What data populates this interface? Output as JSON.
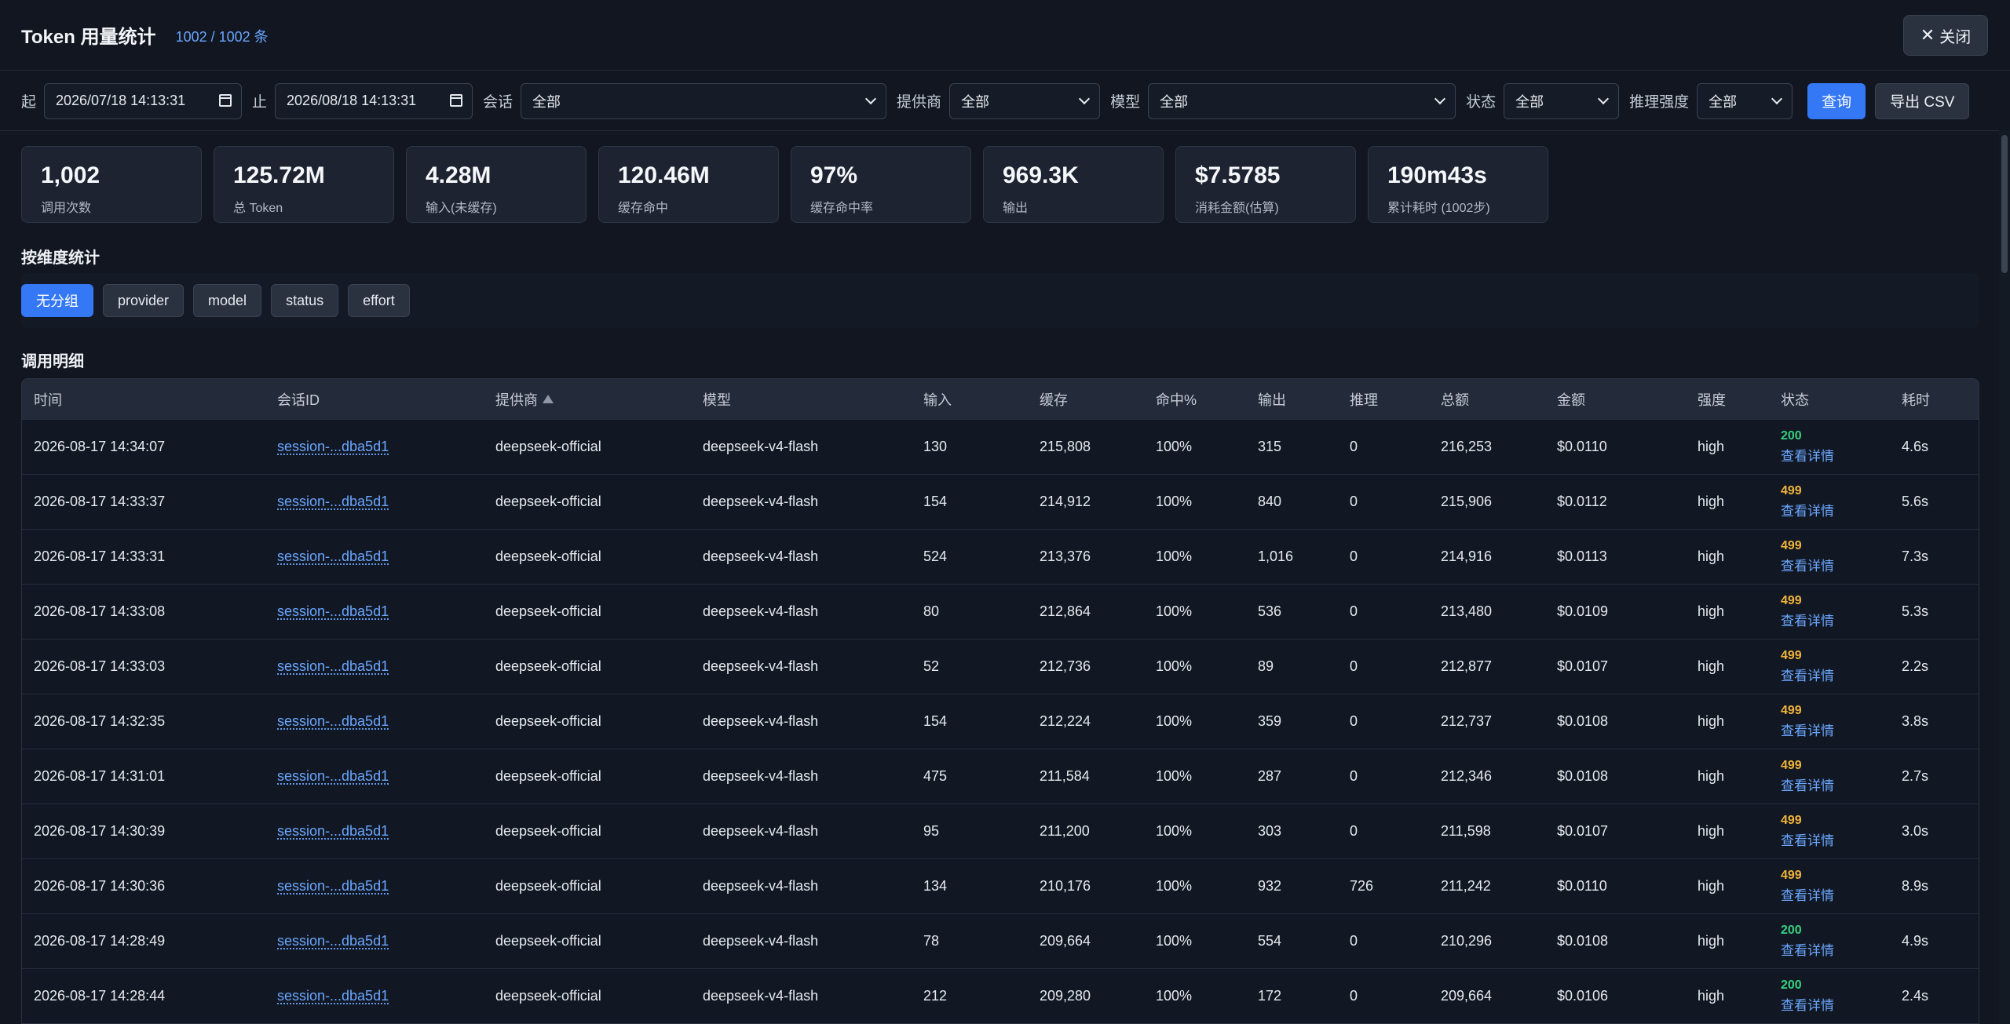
{
  "header": {
    "title": "Token 用量统计",
    "count": "1002 / 1002 条",
    "close_label": "关闭"
  },
  "filters": {
    "start_label": "起",
    "start_value": "2026/07/18 14:13:31",
    "end_label": "止",
    "end_value": "2026/08/18 14:13:31",
    "session_label": "会话",
    "session_value": "全部",
    "provider_label": "提供商",
    "provider_value": "全部",
    "model_label": "模型",
    "model_value": "全部",
    "status_label": "状态",
    "status_value": "全部",
    "effort_label": "推理强度",
    "effort_value": "全部",
    "query_label": "查询",
    "export_label": "导出 CSV"
  },
  "stats": [
    {
      "value": "1,002",
      "label": "调用次数"
    },
    {
      "value": "125.72M",
      "label": "总 Token"
    },
    {
      "value": "4.28M",
      "label": "输入(未缓存)"
    },
    {
      "value": "120.46M",
      "label": "缓存命中"
    },
    {
      "value": "97%",
      "label": "缓存命中率"
    },
    {
      "value": "969.3K",
      "label": "输出"
    },
    {
      "value": "$7.5785",
      "label": "消耗金额(估算)"
    },
    {
      "value": "190m43s",
      "label": "累计耗时 (1002步)"
    }
  ],
  "grouping": {
    "title": "按维度统计",
    "buttons": [
      {
        "label": "无分组",
        "active": true
      },
      {
        "label": "provider",
        "active": false
      },
      {
        "label": "model",
        "active": false
      },
      {
        "label": "status",
        "active": false
      },
      {
        "label": "effort",
        "active": false
      }
    ]
  },
  "table": {
    "title": "调用明细",
    "columns": [
      "时间",
      "会话ID",
      "提供商",
      "模型",
      "输入",
      "缓存",
      "命中%",
      "输出",
      "推理",
      "总额",
      "金额",
      "强度",
      "状态",
      "耗时"
    ],
    "detail_label": "查看详情",
    "rows": [
      [
        "2026-08-17 14:34:07",
        "session-...dba5d1",
        "deepseek-official",
        "deepseek-v4-flash",
        "130",
        "215,808",
        "100%",
        "315",
        "0",
        "216,253",
        "$0.0110",
        "high",
        "200",
        "4.6s"
      ],
      [
        "2026-08-17 14:33:37",
        "session-...dba5d1",
        "deepseek-official",
        "deepseek-v4-flash",
        "154",
        "214,912",
        "100%",
        "840",
        "0",
        "215,906",
        "$0.0112",
        "high",
        "499",
        "5.6s"
      ],
      [
        "2026-08-17 14:33:31",
        "session-...dba5d1",
        "deepseek-official",
        "deepseek-v4-flash",
        "524",
        "213,376",
        "100%",
        "1,016",
        "0",
        "214,916",
        "$0.0113",
        "high",
        "499",
        "7.3s"
      ],
      [
        "2026-08-17 14:33:08",
        "session-...dba5d1",
        "deepseek-official",
        "deepseek-v4-flash",
        "80",
        "212,864",
        "100%",
        "536",
        "0",
        "213,480",
        "$0.0109",
        "high",
        "499",
        "5.3s"
      ],
      [
        "2026-08-17 14:33:03",
        "session-...dba5d1",
        "deepseek-official",
        "deepseek-v4-flash",
        "52",
        "212,736",
        "100%",
        "89",
        "0",
        "212,877",
        "$0.0107",
        "high",
        "499",
        "2.2s"
      ],
      [
        "2026-08-17 14:32:35",
        "session-...dba5d1",
        "deepseek-official",
        "deepseek-v4-flash",
        "154",
        "212,224",
        "100%",
        "359",
        "0",
        "212,737",
        "$0.0108",
        "high",
        "499",
        "3.8s"
      ],
      [
        "2026-08-17 14:31:01",
        "session-...dba5d1",
        "deepseek-official",
        "deepseek-v4-flash",
        "475",
        "211,584",
        "100%",
        "287",
        "0",
        "212,346",
        "$0.0108",
        "high",
        "499",
        "2.7s"
      ],
      [
        "2026-08-17 14:30:39",
        "session-...dba5d1",
        "deepseek-official",
        "deepseek-v4-flash",
        "95",
        "211,200",
        "100%",
        "303",
        "0",
        "211,598",
        "$0.0107",
        "high",
        "499",
        "3.0s"
      ],
      [
        "2026-08-17 14:30:36",
        "session-...dba5d1",
        "deepseek-official",
        "deepseek-v4-flash",
        "134",
        "210,176",
        "100%",
        "932",
        "726",
        "211,242",
        "$0.0110",
        "high",
        "499",
        "8.9s"
      ],
      [
        "2026-08-17 14:28:49",
        "session-...dba5d1",
        "deepseek-official",
        "deepseek-v4-flash",
        "78",
        "209,664",
        "100%",
        "554",
        "0",
        "210,296",
        "$0.0108",
        "high",
        "200",
        "4.9s"
      ],
      [
        "2026-08-17 14:28:44",
        "session-...dba5d1",
        "deepseek-official",
        "deepseek-v4-flash",
        "212",
        "209,280",
        "100%",
        "172",
        "0",
        "209,664",
        "$0.0106",
        "high",
        "200",
        "2.4s"
      ]
    ]
  },
  "colors": {
    "accent": "#3478f6",
    "link": "#6aa6ff",
    "status_ok": "#35d07f",
    "status_warn": "#f0b43a"
  }
}
